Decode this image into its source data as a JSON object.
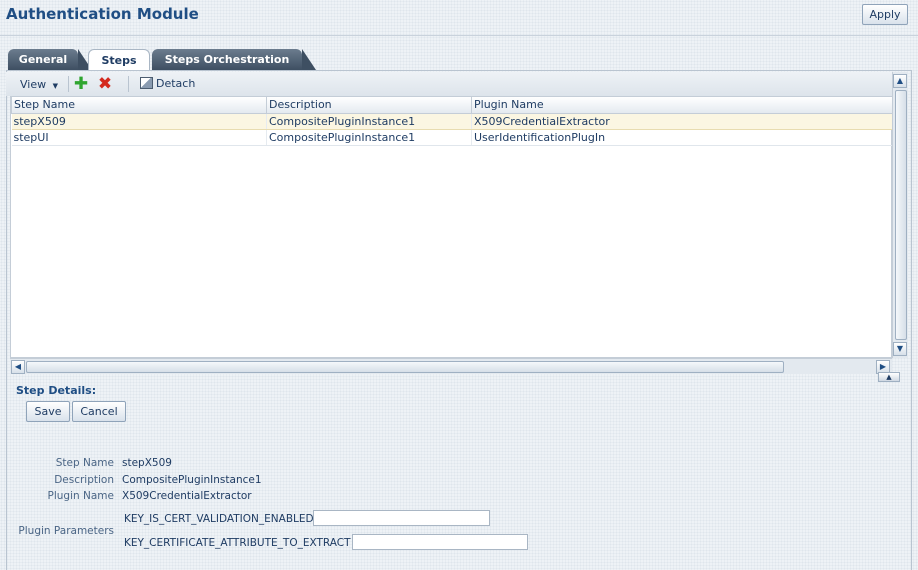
{
  "header": {
    "title": "Authentication Module",
    "apply_label": "Apply"
  },
  "tabs": [
    {
      "label": "General"
    },
    {
      "label": "Steps",
      "active": true
    },
    {
      "label": "Steps Orchestration"
    }
  ],
  "toolbar": {
    "view_label": "View",
    "add_icon": "plus-icon",
    "delete_icon": "x-icon",
    "detach_label": "Detach"
  },
  "table": {
    "columns": [
      "Step Name",
      "Description",
      "Plugin Name"
    ],
    "rows": [
      {
        "step_name": "stepX509",
        "description": "CompositePluginInstance1",
        "plugin_name": "X509CredentialExtractor",
        "selected": true
      },
      {
        "step_name": "stepUI",
        "description": "CompositePluginInstance1",
        "plugin_name": "UserIdentificationPlugIn",
        "selected": false
      }
    ]
  },
  "details": {
    "title": "Step Details:",
    "save_label": "Save",
    "cancel_label": "Cancel",
    "fields": {
      "step_name_label": "Step Name",
      "step_name_value": "stepX509",
      "description_label": "Description",
      "description_value": "CompositePluginInstance1",
      "plugin_name_label": "Plugin Name",
      "plugin_name_value": "X509CredentialExtractor",
      "plugin_parameters_label": "Plugin Parameters"
    },
    "params": [
      {
        "name": "KEY_IS_CERT_VALIDATION_ENABLED",
        "value": ""
      },
      {
        "name": "KEY_CERTIFICATE_ATTRIBUTE_TO_EXTRACT",
        "value": ""
      }
    ]
  },
  "colors": {
    "title": "#1f4e84",
    "tab_dark": "#3e4f62",
    "selected_row": "#fbf6e2",
    "add_green": "#2fa52f",
    "delete_red": "#d42a1e"
  }
}
